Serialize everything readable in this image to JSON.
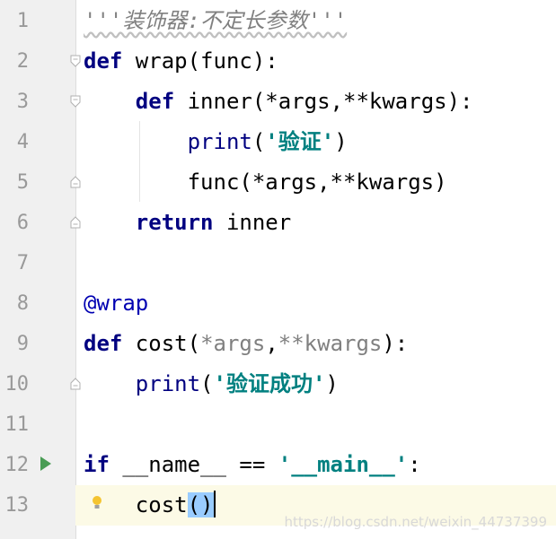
{
  "editor": {
    "lines": [
      {
        "num": "1",
        "tokens": [
          {
            "t": "'''装饰器:不定长参数'''",
            "c": "doc"
          }
        ]
      },
      {
        "num": "2",
        "tokens": [
          {
            "t": "def",
            "c": "kw"
          },
          {
            "t": " wrap(func):",
            "c": ""
          }
        ]
      },
      {
        "num": "3",
        "tokens": [
          {
            "t": "    ",
            "c": ""
          },
          {
            "t": "def",
            "c": "kw"
          },
          {
            "t": " inner(*args,**kwargs):",
            "c": ""
          }
        ]
      },
      {
        "num": "4",
        "tokens": [
          {
            "t": "        ",
            "c": ""
          },
          {
            "t": "print",
            "c": "builtin"
          },
          {
            "t": "(",
            "c": ""
          },
          {
            "t": "'验证'",
            "c": "str"
          },
          {
            "t": ")",
            "c": ""
          }
        ]
      },
      {
        "num": "5",
        "tokens": [
          {
            "t": "        func(*args,**kwargs)",
            "c": ""
          }
        ]
      },
      {
        "num": "6",
        "tokens": [
          {
            "t": "    ",
            "c": ""
          },
          {
            "t": "return",
            "c": "kw"
          },
          {
            "t": " inner",
            "c": ""
          }
        ]
      },
      {
        "num": "7",
        "tokens": []
      },
      {
        "num": "8",
        "tokens": [
          {
            "t": "@wrap",
            "c": "deco"
          }
        ]
      },
      {
        "num": "9",
        "tokens": [
          {
            "t": "def",
            "c": "kw"
          },
          {
            "t": " cost(",
            "c": ""
          },
          {
            "t": "*args",
            "c": "param"
          },
          {
            "t": ",",
            "c": ""
          },
          {
            "t": "**kwargs",
            "c": "param"
          },
          {
            "t": "):",
            "c": ""
          }
        ]
      },
      {
        "num": "10",
        "tokens": [
          {
            "t": "    ",
            "c": ""
          },
          {
            "t": "print",
            "c": "builtin"
          },
          {
            "t": "(",
            "c": ""
          },
          {
            "t": "'验证成功'",
            "c": "str"
          },
          {
            "t": ")",
            "c": ""
          }
        ]
      },
      {
        "num": "11",
        "tokens": []
      },
      {
        "num": "12",
        "tokens": [
          {
            "t": "if",
            "c": "kw"
          },
          {
            "t": " __name__ == ",
            "c": ""
          },
          {
            "t": "'__main__'",
            "c": "str"
          },
          {
            "t": ":",
            "c": ""
          }
        ]
      },
      {
        "num": "13",
        "tokens": [
          {
            "t": "    cost",
            "c": ""
          },
          {
            "t": "()",
            "c": "brace"
          }
        ]
      }
    ],
    "current_line": "13"
  },
  "icons": {
    "run": "run-arrow-icon",
    "bulb": "lightbulb-icon",
    "fold": "fold-marker-icon"
  },
  "colors": {
    "keyword": "#000080",
    "string": "#008080",
    "docstring": "#808080",
    "decorator": "#0000b2",
    "run_green": "#499c54",
    "bulb_yellow": "#f4c430"
  },
  "watermark": "https://blog.csdn.net/weixin_44737399"
}
